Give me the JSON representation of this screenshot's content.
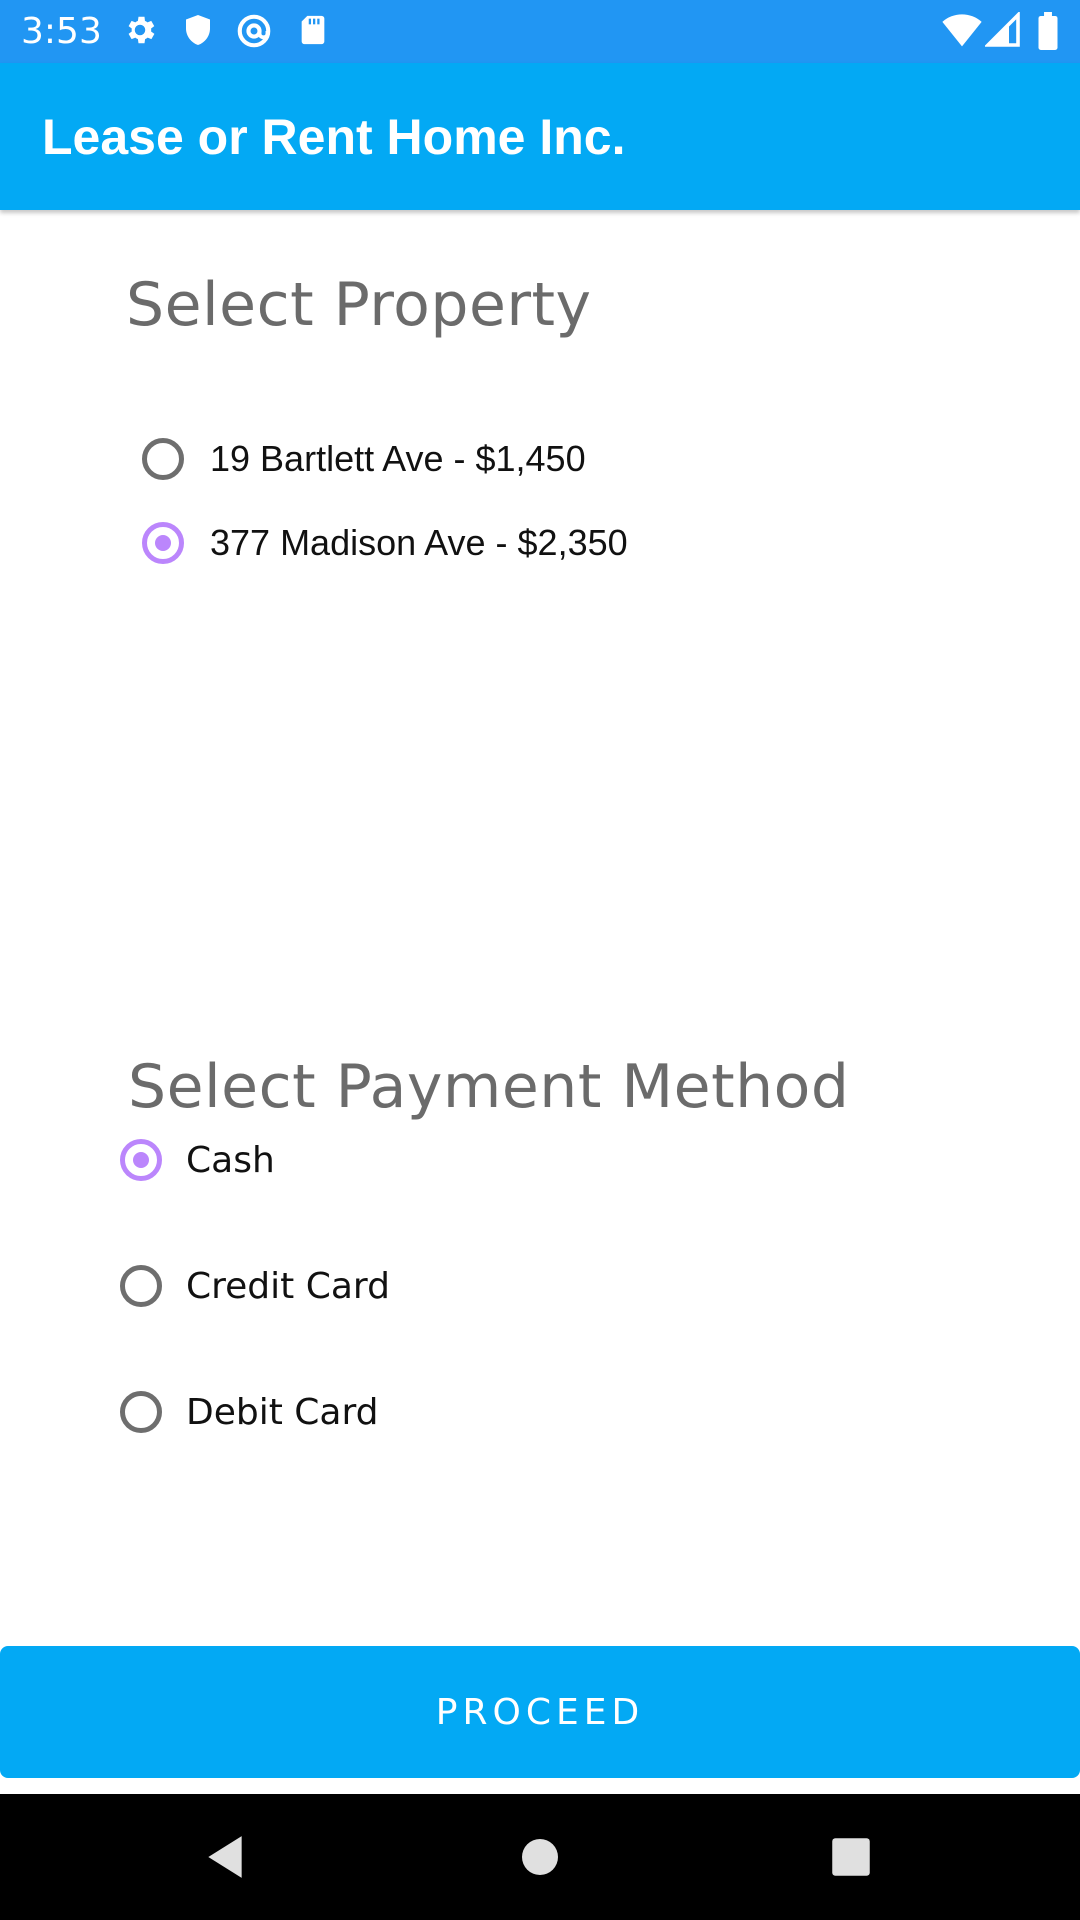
{
  "status_bar": {
    "time": "3:53",
    "left_icons": [
      "gear-icon",
      "shield-icon",
      "at-sign-icon",
      "sd-card-icon"
    ],
    "right_icons": [
      "wifi-icon",
      "signal-icon",
      "battery-icon"
    ]
  },
  "app_bar": {
    "title": "Lease or Rent Home Inc."
  },
  "property_section": {
    "heading": "Select Property",
    "options": [
      {
        "label": "19 Bartlett Ave - $1,450",
        "selected": false
      },
      {
        "label": "377 Madison Ave - $2,350",
        "selected": true
      }
    ]
  },
  "payment_section": {
    "heading": "Select Payment Method",
    "options": [
      {
        "label": "Cash",
        "selected": true
      },
      {
        "label": "Credit Card",
        "selected": false
      },
      {
        "label": "Debit Card",
        "selected": false
      }
    ]
  },
  "actions": {
    "proceed_label": "PROCEED"
  },
  "nav_bar": {
    "icons": [
      "back-icon",
      "home-icon",
      "recents-icon"
    ]
  },
  "colors": {
    "status_bar": "#2196f3",
    "app_bar": "#03a9f4",
    "radio_accent": "#bb86fc",
    "button": "#03a9f4"
  }
}
